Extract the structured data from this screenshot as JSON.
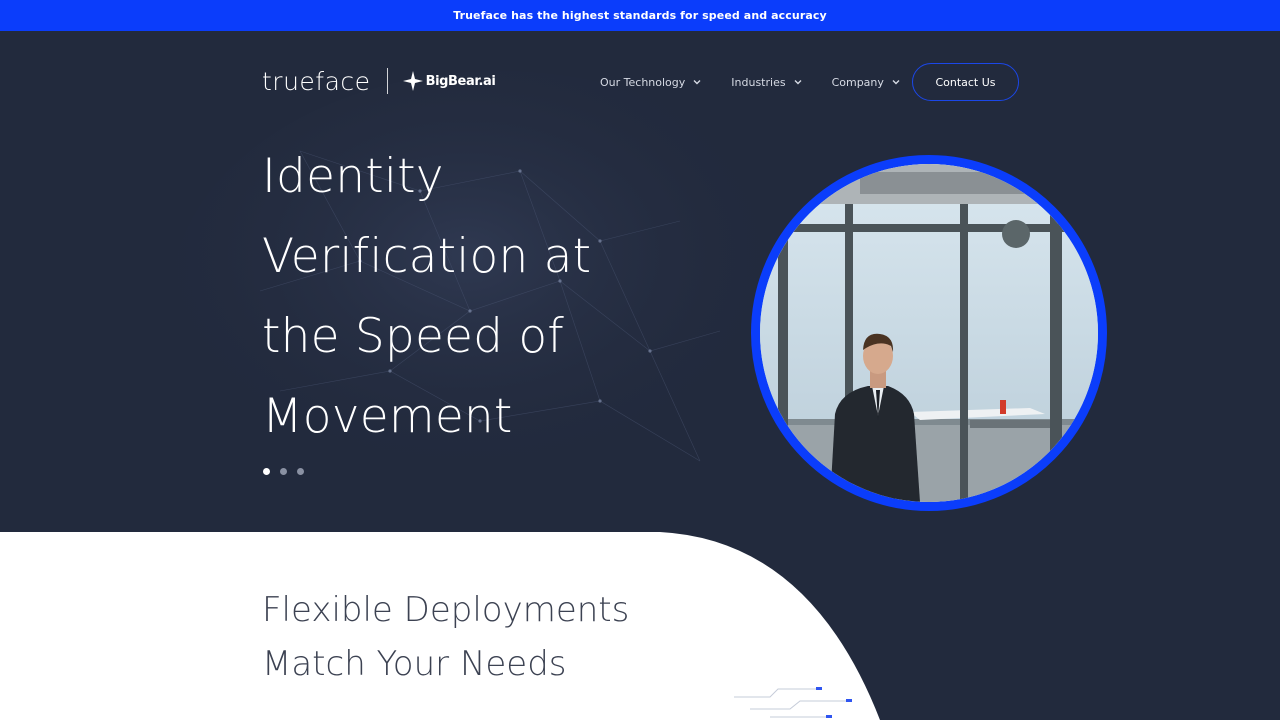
{
  "announcement": {
    "text": "Trueface has the highest standards for speed and accuracy"
  },
  "brand": {
    "logo_text": "trueface",
    "partner_name": "BigBear.ai",
    "accent_color": "#0b3dfb",
    "background_color": "#222a3d"
  },
  "nav": {
    "items": [
      {
        "label": "Our Technology",
        "icon": "chevron-down-icon"
      },
      {
        "label": "Industries",
        "icon": "chevron-down-icon"
      },
      {
        "label": "Company",
        "icon": "chevron-down-icon"
      }
    ],
    "cta_label": "Contact Us"
  },
  "hero": {
    "headline_lines": [
      "Identity",
      "Verification at",
      "the Speed of",
      "Movement"
    ],
    "slides_total": 3,
    "active_slide": 1
  },
  "section": {
    "title_lines": [
      "Flexible Deployments",
      "Match Your Needs"
    ]
  }
}
